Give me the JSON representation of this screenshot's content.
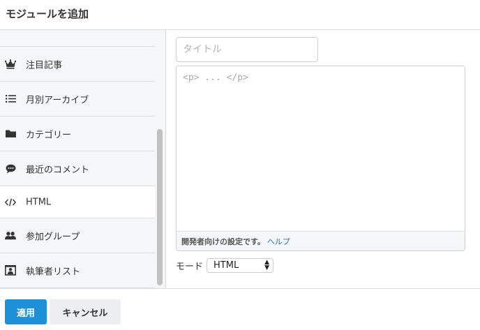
{
  "header": {
    "title": "モジュールを追加"
  },
  "sidebar": {
    "items": [
      {
        "label": "注目記事",
        "icon": "crown-icon"
      },
      {
        "label": "月別アーカイブ",
        "icon": "list-icon"
      },
      {
        "label": "カテゴリー",
        "icon": "folder-icon"
      },
      {
        "label": "最近のコメント",
        "icon": "comment-icon"
      },
      {
        "label": "HTML",
        "icon": "code-icon"
      },
      {
        "label": "参加グループ",
        "icon": "group-icon"
      },
      {
        "label": "執筆者リスト",
        "icon": "contact-card-icon"
      }
    ]
  },
  "main": {
    "title_placeholder": "タイトル",
    "html_placeholder": "<p> ... </p>",
    "footer_note": "開発者向けの設定です。",
    "help_link": "ヘルプ",
    "mode_label": "モード",
    "mode_value": "HTML"
  },
  "footer": {
    "apply_label": "適用",
    "cancel_label": "キャンセル"
  },
  "colors": {
    "accent": "#1e90d8",
    "link": "#2a6fb0",
    "sidebar_bg": "#f5f6f7"
  }
}
